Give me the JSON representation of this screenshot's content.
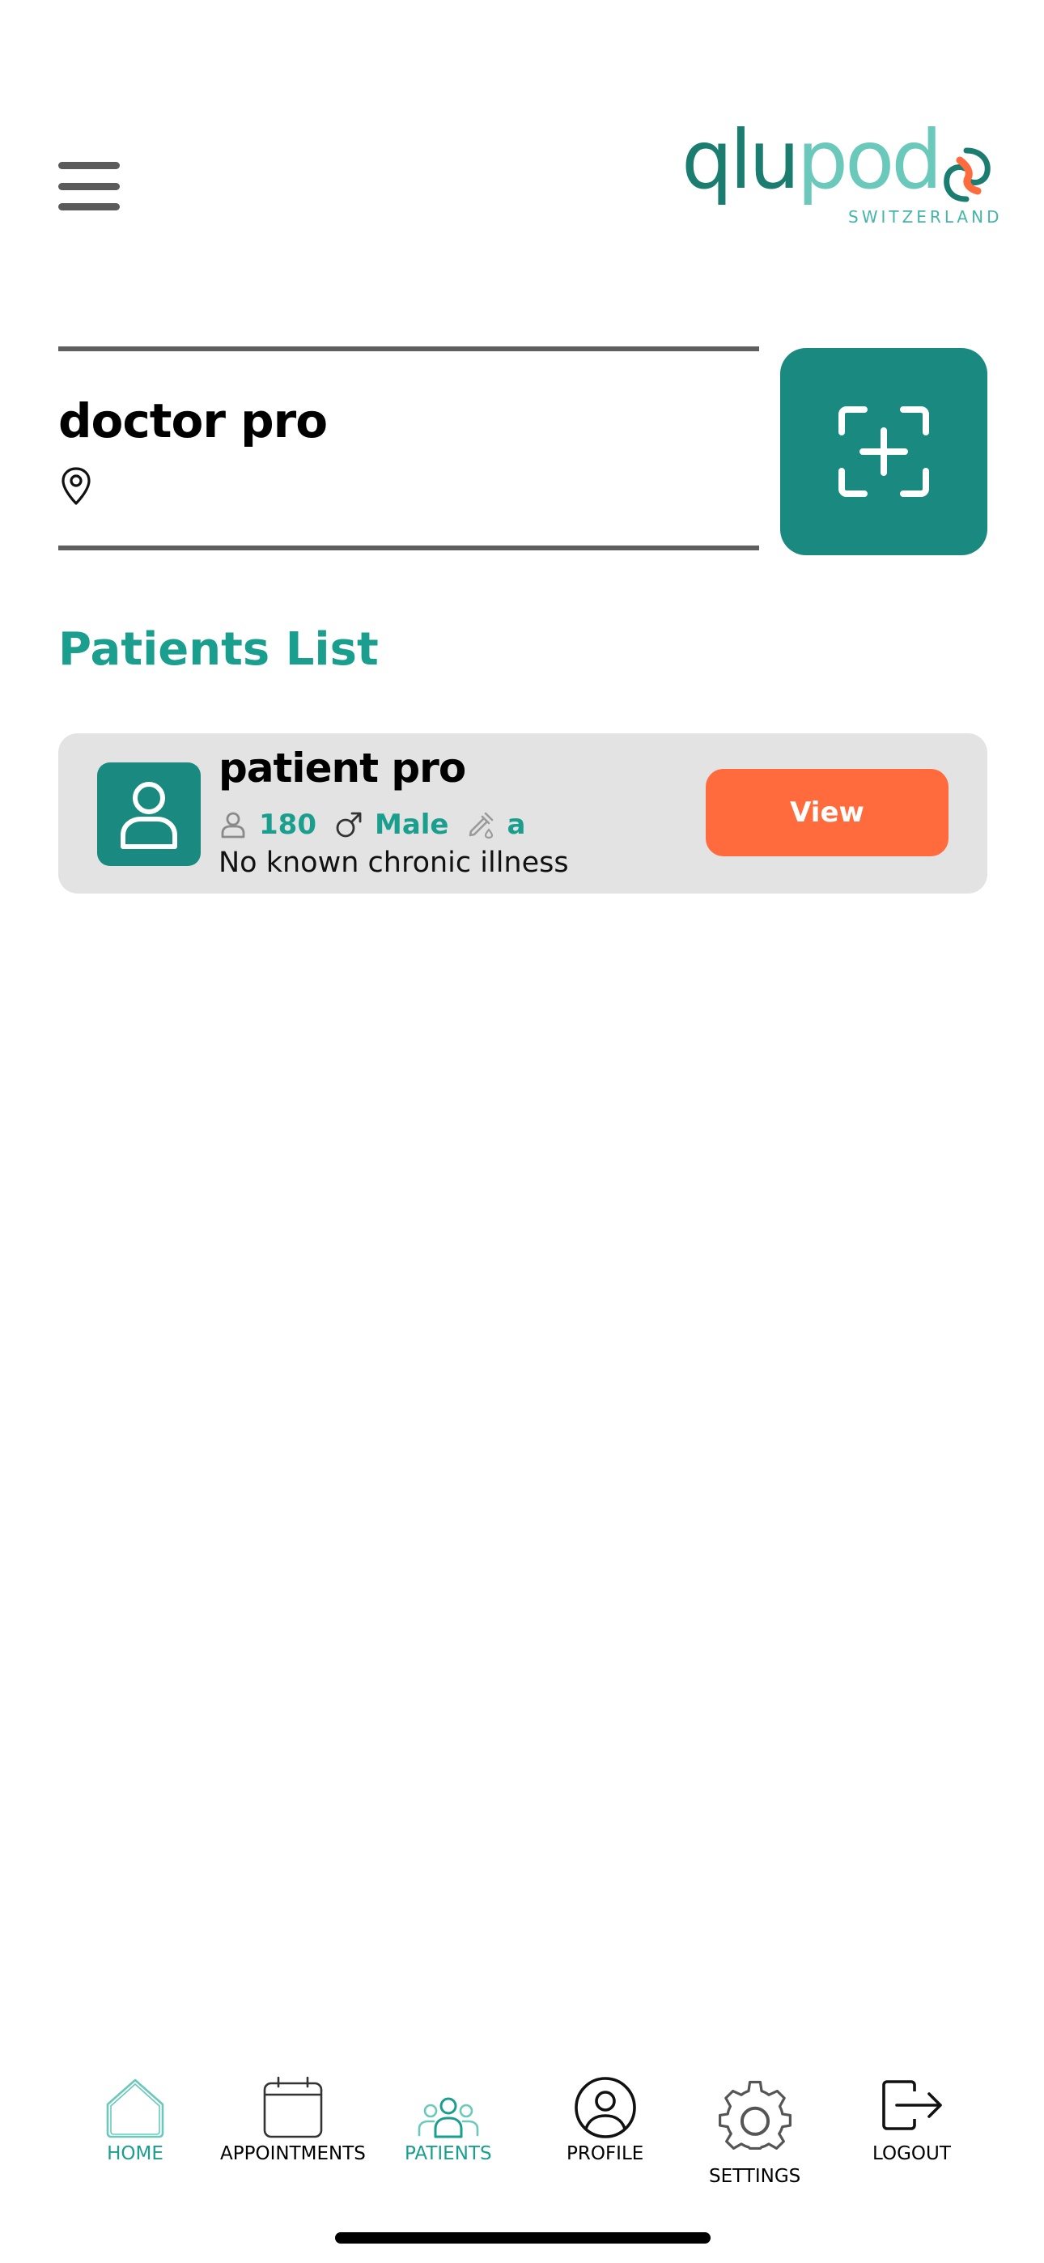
{
  "header": {
    "logo": {
      "word_dark": "qlu",
      "word_light": "pod",
      "subtitle": "SWITZERLAND"
    }
  },
  "doctor": {
    "name": "doctor pro",
    "location": ""
  },
  "patients_section": {
    "title": "Patients List"
  },
  "patients": [
    {
      "name": "patient pro",
      "height": "180",
      "gender": "Male",
      "blood": "a",
      "condition": "No known chronic illness",
      "view_label": "View"
    }
  ],
  "nav": {
    "items": [
      {
        "label": "HOME",
        "icon": "home-icon"
      },
      {
        "label": "APPOINTMENTS",
        "icon": "calendar-icon"
      },
      {
        "label": "PATIENTS",
        "icon": "patients-icon"
      },
      {
        "label": "PROFILE",
        "icon": "profile-icon"
      },
      {
        "label": "SETTINGS",
        "icon": "gear-icon"
      },
      {
        "label": "LOGOUT",
        "icon": "logout-icon"
      }
    ],
    "active": "PATIENTS"
  },
  "colors": {
    "brand_teal": "#1a8a80",
    "accent_orange": "#ff6b3d",
    "title_teal": "#1a9e8e"
  }
}
